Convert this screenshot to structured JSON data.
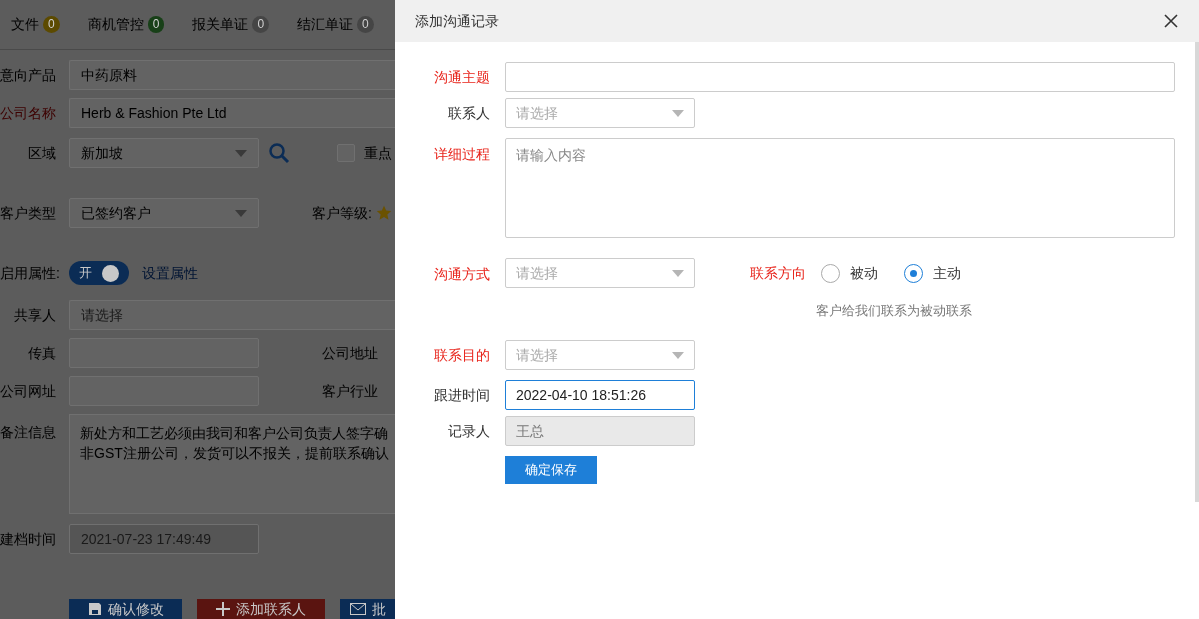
{
  "background": {
    "tabs": [
      {
        "label": "文件",
        "badge": "0",
        "color": "#5c4a00"
      },
      {
        "label": "商机管控",
        "badge": "0",
        "color": "#184018"
      },
      {
        "label": "报关单证",
        "badge": "0",
        "color": "#454545"
      },
      {
        "label": "结汇单证",
        "badge": "0",
        "color": "#454545"
      }
    ],
    "intended_product": {
      "label": "意向产品",
      "required": false,
      "value": "中药原料"
    },
    "company_name": {
      "label": "公司名称",
      "required": true,
      "value": "Herb & Fashion Pte Ltd"
    },
    "region": {
      "label": "区域",
      "value": "新加坡"
    },
    "key_customer": {
      "label": "重点",
      "checked": false
    },
    "customer_type": {
      "label": "客户类型",
      "value": "已签约客户"
    },
    "customer_level": {
      "label": "客户等级:"
    },
    "enable_attributes": {
      "label": "启用属性:",
      "switch_label": "开",
      "on": true,
      "link": "设置属性"
    },
    "sharer": {
      "label": "共享人",
      "placeholder": "请选择"
    },
    "fax": {
      "label": "传真"
    },
    "company_address": {
      "label": "公司地址"
    },
    "website": {
      "label": "公司网址"
    },
    "industry": {
      "label": "客户行业"
    },
    "remarks": {
      "label": "备注信息",
      "lines": [
        "新处方和工艺必须由我司和客户公司负责人签字确",
        "非GST注册公司，发货可以不报关，提前联系确认"
      ]
    },
    "created_time": {
      "label": "建档时间",
      "value": "2021-07-23 17:49:49"
    },
    "buttons": [
      {
        "kind": "save",
        "label": "确认修改",
        "color": "#0b2c55"
      },
      {
        "kind": "add",
        "label": "添加联系人",
        "color": "#5a1410"
      },
      {
        "kind": "mail",
        "label": "批",
        "color": "#0b2c55"
      }
    ]
  },
  "dialog": {
    "title": "添加沟通记录",
    "fields": [
      {
        "kind": "text",
        "label": "沟通主题",
        "required": true
      },
      {
        "kind": "select",
        "label": "联系人",
        "required": false,
        "placeholder": "请选择"
      },
      {
        "kind": "textarea",
        "label": "详细过程",
        "required": true,
        "placeholder": "请输入内容"
      },
      {
        "kind": "select_radio",
        "label": "沟通方式",
        "required": true,
        "placeholder": "请选择",
        "radio_label": "联系方向",
        "radio_required": true,
        "options": [
          {
            "label": "被动",
            "selected": false
          },
          {
            "label": "主动",
            "selected": true
          }
        ],
        "hint": "客户给我们联系为被动联系"
      },
      {
        "kind": "select",
        "label": "联系目的",
        "required": true,
        "placeholder": "请选择"
      },
      {
        "kind": "text",
        "label": "跟进时间",
        "required": false,
        "value": "2022-04-10 18:51:26",
        "focused": true
      },
      {
        "kind": "text",
        "label": "记录人",
        "required": false,
        "value": "王总",
        "disabled": true
      }
    ],
    "submit": "确定保存"
  }
}
